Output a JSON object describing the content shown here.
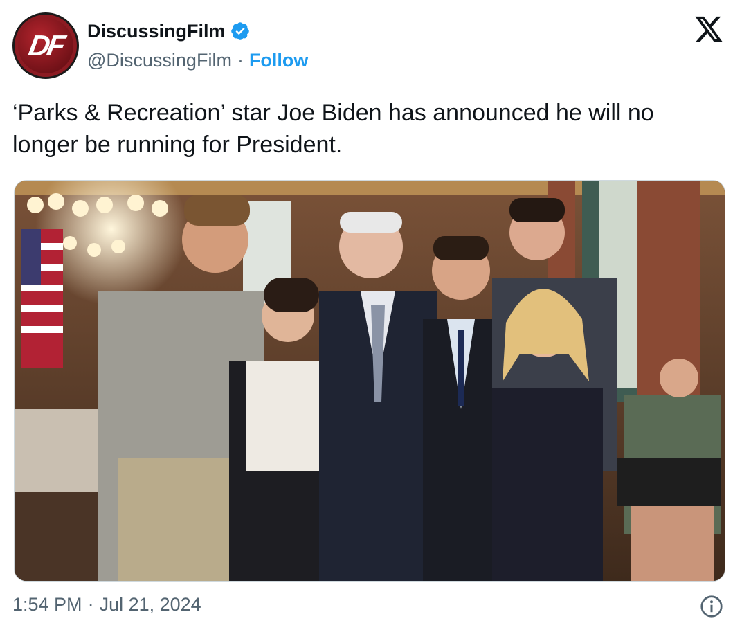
{
  "account": {
    "display_name": "DiscussingFilm",
    "handle": "@DiscussingFilm",
    "separator": "·",
    "follow_label": "Follow",
    "avatar_text": "DF",
    "verified_icon": "verified-badge-icon"
  },
  "platform": {
    "logo_icon": "x-logo-icon"
  },
  "tweet": {
    "text": "‘Parks & Recreation’ star Joe Biden has announced he will no longer be running for President.",
    "image_icon": "group-photo-image"
  },
  "footer": {
    "time": "1:54 PM",
    "separator": "·",
    "date": "Jul 21, 2024",
    "info_icon": "info-icon"
  },
  "colors": {
    "accent": "#1d9bf0",
    "secondary_text": "#536471",
    "primary_text": "#0f1419",
    "avatar_red": "#8c1b22"
  }
}
